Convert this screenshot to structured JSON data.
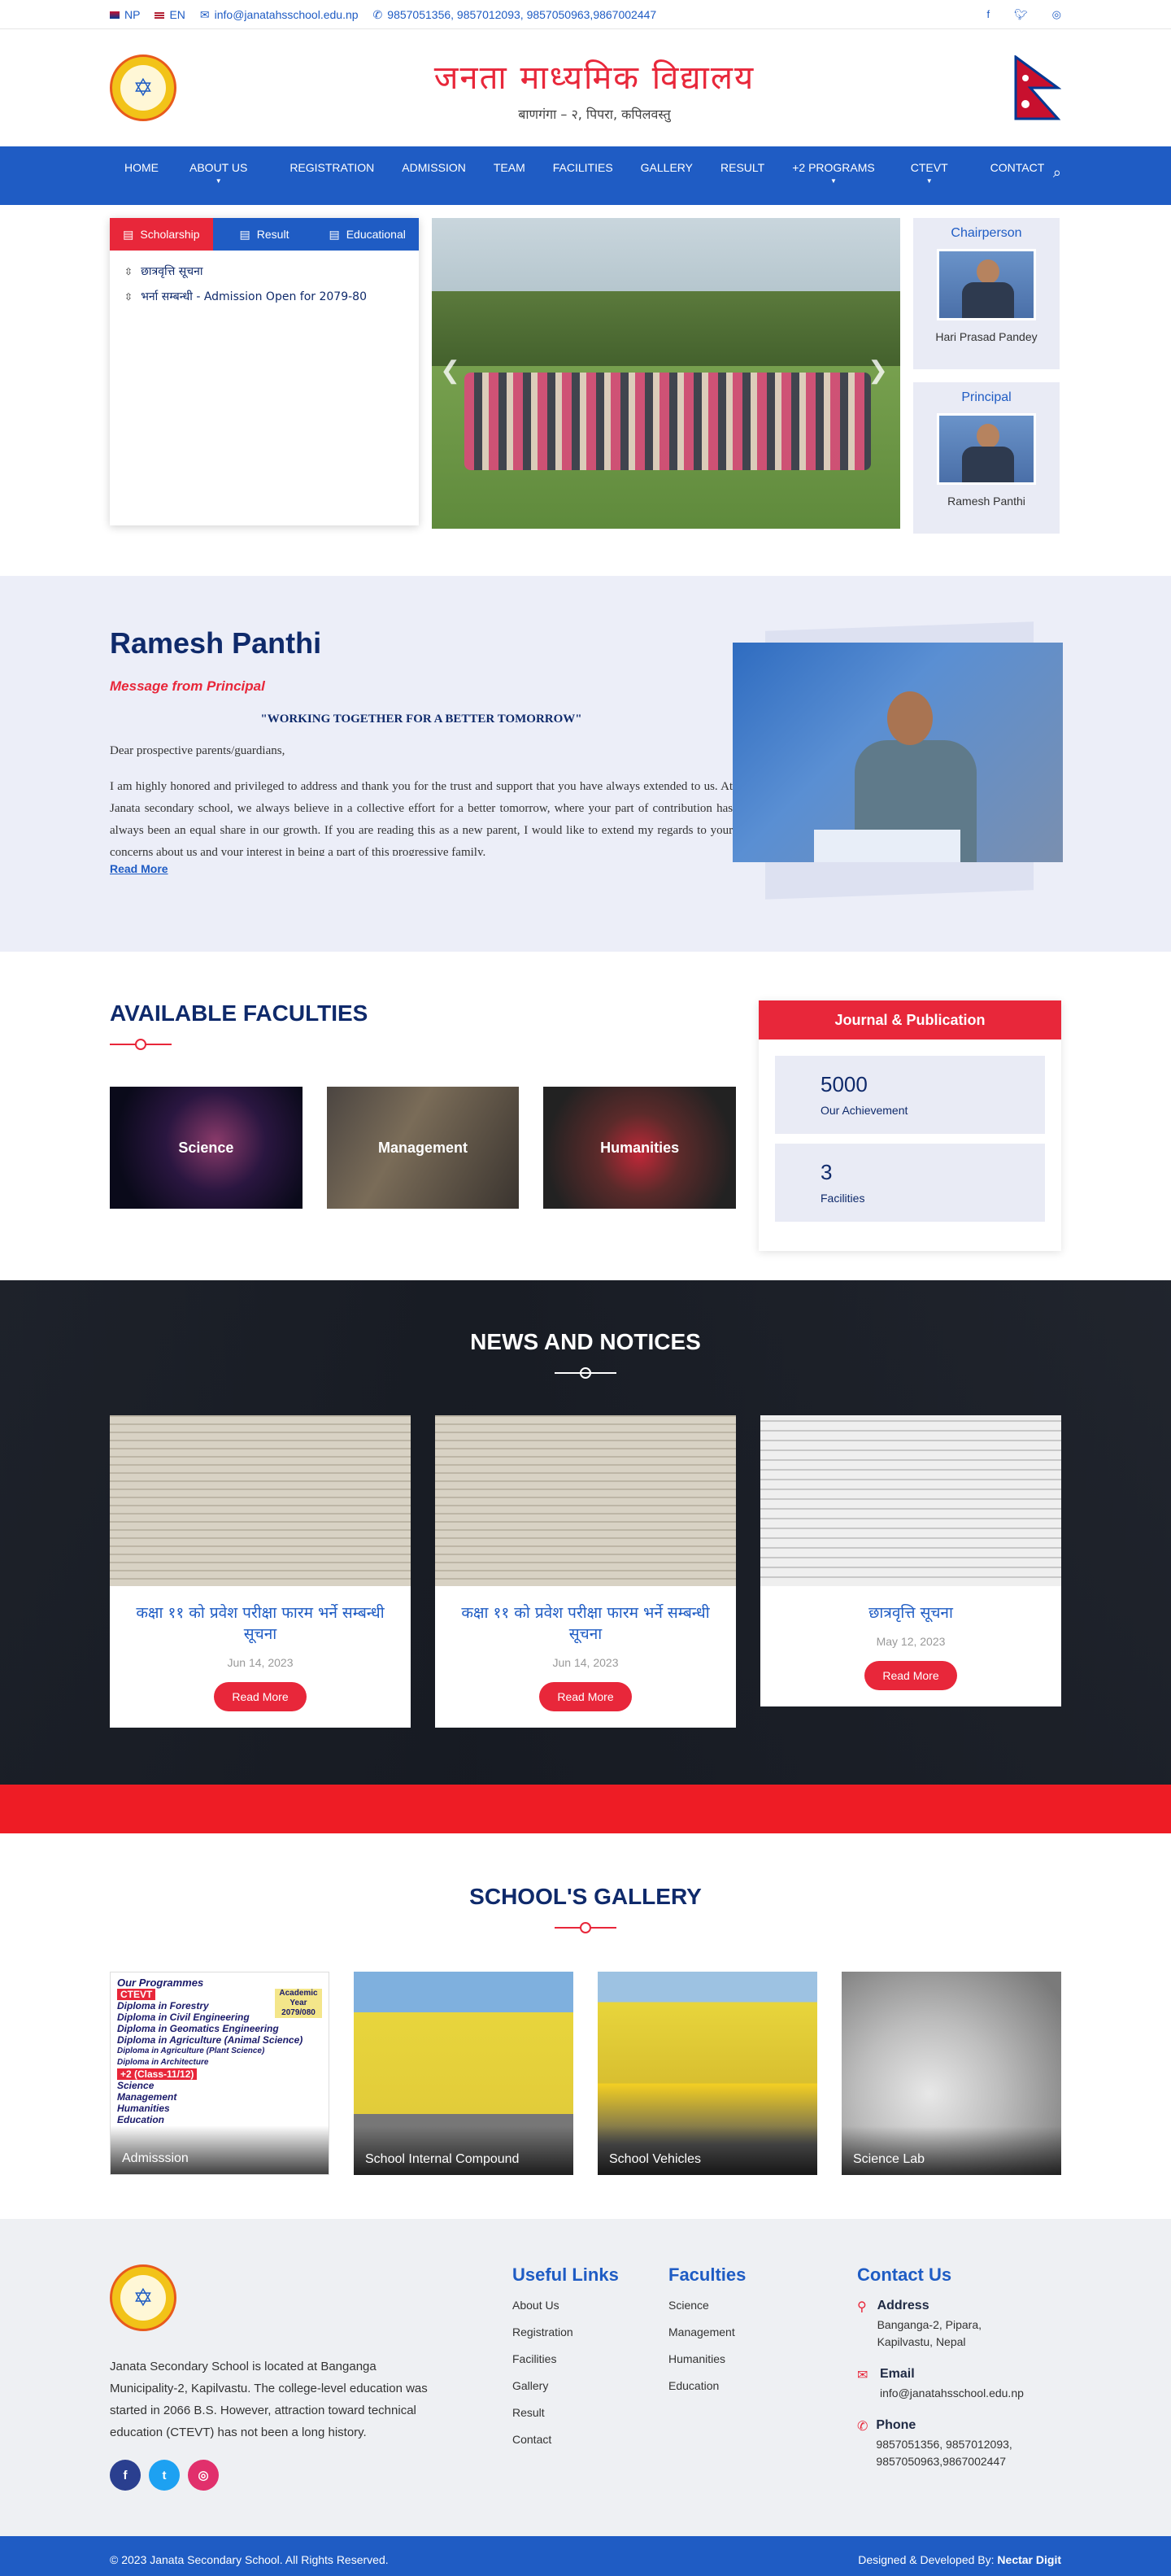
{
  "topbar": {
    "lang_np": "NP",
    "lang_en": "EN",
    "email": "info@janatahsschool.edu.np",
    "phones": "9857051356, 9857012093, 9857050963,9867002447",
    "social_icons": [
      "facebook-icon",
      "twitter-icon",
      "instagram-icon"
    ]
  },
  "header": {
    "title": "जनता माध्यमिक विद्यालय",
    "subtitle": "बाणगंगा – २, पिपरा, कपिलवस्तु"
  },
  "nav": {
    "items": [
      "HOME",
      "ABOUT US",
      "REGISTRATION",
      "ADMISSION",
      "TEAM",
      "FACILITIES",
      "GALLERY",
      "RESULT",
      "+2 PROGRAMS",
      "CTEVT",
      "CONTACT"
    ]
  },
  "tabs": {
    "scholarship": "Scholarship",
    "result": "Result",
    "educational": "Educational",
    "notices": [
      {
        "text": "छात्रवृत्ति सूचना"
      },
      {
        "text": "भर्ना सम्बन्धी - Admission Open for 2079-80"
      }
    ]
  },
  "people": {
    "chair_role": "Chairperson",
    "chair_name": "Hari Prasad Pandey",
    "principal_role": "Principal",
    "principal_name": "Ramesh Panthi"
  },
  "message": {
    "name": "Ramesh Panthi",
    "subtitle": "Message from Principal",
    "quote": "\"WORKING TOGETHER FOR A BETTER TOMORROW\"",
    "greeting": "Dear prospective parents/guardians,",
    "body": "I am highly honored and privileged to address and thank you for the trust and support that you have always extended to us. At Janata secondary school, we always believe in a collective effort for a better tomorrow, where your part of contribution has always been an equal share in our growth. If you are reading this as a new parent, I would like to extend my regards to your concerns about us and your interest in being a part of this progressive family.",
    "read_more": "Read More"
  },
  "faculties": {
    "title": "AVAILABLE FACULTIES",
    "items": [
      "Science",
      "Management",
      "Humanities"
    ]
  },
  "journal": {
    "title": "Journal & Publication",
    "stats": [
      {
        "num": "5000",
        "label": "Our Achievement"
      },
      {
        "num": "3",
        "label": "Facilities"
      }
    ]
  },
  "news": {
    "title": "NEWS AND NOTICES",
    "items": [
      {
        "title": "कक्षा ११ को प्रवेश परीक्षा फारम भर्ने सम्बन्धी सूचना",
        "date": "Jun 14, 2023",
        "btn": "Read More"
      },
      {
        "title": "कक्षा ११ को प्रवेश परीक्षा फारम भर्ने सम्बन्धी सूचना",
        "date": "Jun 14, 2023",
        "btn": "Read More"
      },
      {
        "title": "छात्रवृत्ति सूचना",
        "date": "May 12, 2023",
        "btn": "Read More"
      }
    ]
  },
  "gallery": {
    "title": "SCHOOL'S GALLERY",
    "items": [
      "Admisssion",
      "School Internal Compound",
      "School Vehicles",
      "Science Lab"
    ],
    "poster": {
      "heading": "Our Programmes",
      "tag": "CTEVT",
      "year": "Academic Year 2079/080",
      "lines": [
        "Diploma in Forestry",
        "Diploma in Civil Engineering",
        "Diploma in Geomatics Engineering",
        "Diploma in Agriculture (Animal Science)",
        "Diploma in Agriculture (Plant Science)",
        "Diploma in Architecture"
      ],
      "plus2": "+2 (Class-11/12)",
      "streams": [
        "Science",
        "Management",
        "Humanities",
        "Education"
      ]
    }
  },
  "footer": {
    "about": "Janata Secondary School is located at Banganga Municipality-2, Kapilvastu. The college-level education was started in 2066 B.S. However, attraction toward technical education (CTEVT) has not been a long history.",
    "useful_title": "Useful Links",
    "useful": [
      "About Us",
      "Registration",
      "Facilities",
      "Gallery",
      "Result",
      "Contact"
    ],
    "fac_title": "Faculties",
    "fac": [
      "Science",
      "Management",
      "Humanities",
      "Education"
    ],
    "contact_title": "Contact Us",
    "address_label": "Address",
    "address": "Banganga-2, Pipara, Kapilvastu, Nepal",
    "email_label": "Email",
    "email": "info@janatahsschool.edu.np",
    "phone_label": "Phone",
    "phone": "9857051356, 9857012093, 9857050963,9867002447",
    "copyright": "© 2023 Janata Secondary School. All Rights Reserved.",
    "dev_prefix": "Designed & Developed By:",
    "dev_name": "Nectar Digit"
  },
  "colors": {
    "primary": "#1f5cc4",
    "accent": "#e8273a",
    "navy": "#0f2a6b"
  }
}
